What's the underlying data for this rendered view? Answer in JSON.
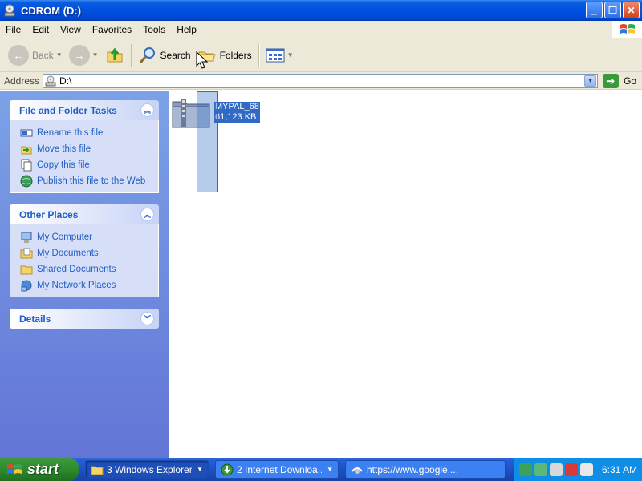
{
  "window": {
    "title": "CDROM (D:)"
  },
  "menu": [
    "File",
    "Edit",
    "View",
    "Favorites",
    "Tools",
    "Help"
  ],
  "toolbar": {
    "back_label": "Back",
    "search_label": "Search",
    "folders_label": "Folders"
  },
  "address": {
    "label": "Address",
    "value": "D:\\",
    "go_label": "Go"
  },
  "tasks": {
    "title": "File and Folder Tasks",
    "items": [
      "Rename this file",
      "Move this file",
      "Copy this file",
      "Publish this file to the Web"
    ]
  },
  "places": {
    "title": "Other Places",
    "items": [
      "My Computer",
      "My Documents",
      "Shared Documents",
      "My Network Places"
    ]
  },
  "details": {
    "title": "Details"
  },
  "file": {
    "name": "MYPAL_68",
    "size": "61,123 KB"
  },
  "taskbar": {
    "start_label": "start",
    "buttons": [
      {
        "label": "3 Windows Explorer",
        "icon": "folder-icon"
      },
      {
        "label": "2 Internet Downloa...",
        "icon": "download-icon"
      },
      {
        "label": "https://www.google....",
        "icon": "browser-icon"
      }
    ],
    "clock": "6:31 AM"
  },
  "colors": {
    "title_bar": "#0050e0",
    "link": "#215dc6",
    "selection": "#316ac5"
  }
}
